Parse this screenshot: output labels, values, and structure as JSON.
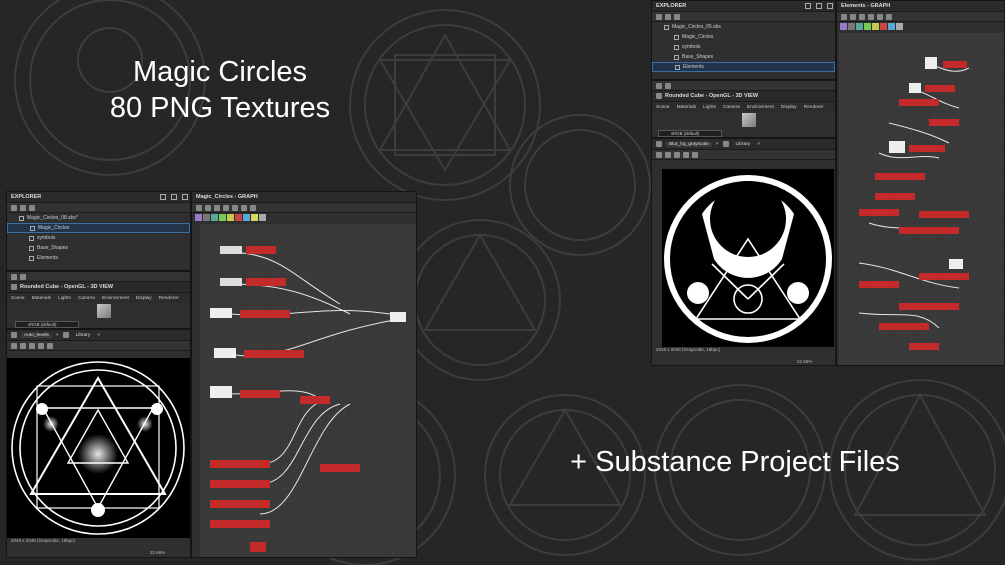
{
  "headline": {
    "line1": "Magic Circles",
    "line2": "80 PNG Textures",
    "line3": "+ Substance Project Files"
  },
  "colors": {
    "background": "#262626",
    "selection": "#3a6ea5",
    "graph_bg": "#3a3a3a",
    "wire": "#e0e0e0",
    "node_accent": "#c42a2a"
  },
  "left": {
    "explorer": {
      "title": "EXPLORER",
      "root": "Magic_Circles_08.sbs*",
      "items": [
        {
          "label": "Magic_Circles",
          "selected": true
        },
        {
          "label": "symbols",
          "selected": false
        },
        {
          "label": "Base_Shapes",
          "selected": false
        },
        {
          "label": "Elements",
          "selected": false
        }
      ]
    },
    "view3d": {
      "title": "Rounded Cube - OpenGL - 3D VIEW",
      "menu": [
        "Scene",
        "Materials",
        "Lights",
        "Camera",
        "Environment",
        "Display",
        "Renderer"
      ],
      "colorspace": "sRGB (default)"
    },
    "viewer2d": {
      "tab_active": "Auto_levels",
      "tab_library": "Library",
      "status": "2048 x 2048 (Grayscale, 16bpc)",
      "zoom": "22.66%"
    },
    "graph": {
      "title": "Magic_Circles - GRAPH"
    }
  },
  "right": {
    "explorer": {
      "title": "EXPLORER",
      "root": "Magic_Circles_05.sbs",
      "items": [
        {
          "label": "Magic_Circles",
          "selected": false
        },
        {
          "label": "symbols",
          "selected": false
        },
        {
          "label": "Base_Shapes",
          "selected": false
        },
        {
          "label": "Elements",
          "selected": true
        }
      ]
    },
    "view3d": {
      "title": "Rounded Cube - OpenGL - 3D VIEW",
      "menu": [
        "Scene",
        "Materials",
        "Lights",
        "Camera",
        "Environment",
        "Display",
        "Renderer"
      ],
      "colorspace": "sRGB (default)"
    },
    "viewer2d": {
      "tab_active": "Blur_hq_grayscale",
      "tab_library": "Library",
      "status": "2048 x 2048 (Grayscale, 16bpc)",
      "zoom": "22.66%"
    },
    "graph": {
      "title": "Elements - GRAPH"
    }
  },
  "icons": [
    "folder-icon",
    "save-icon",
    "info-icon",
    "camera-icon",
    "lock-icon",
    "close-icon",
    "pin-icon",
    "histogram-icon",
    "grid-icon"
  ]
}
